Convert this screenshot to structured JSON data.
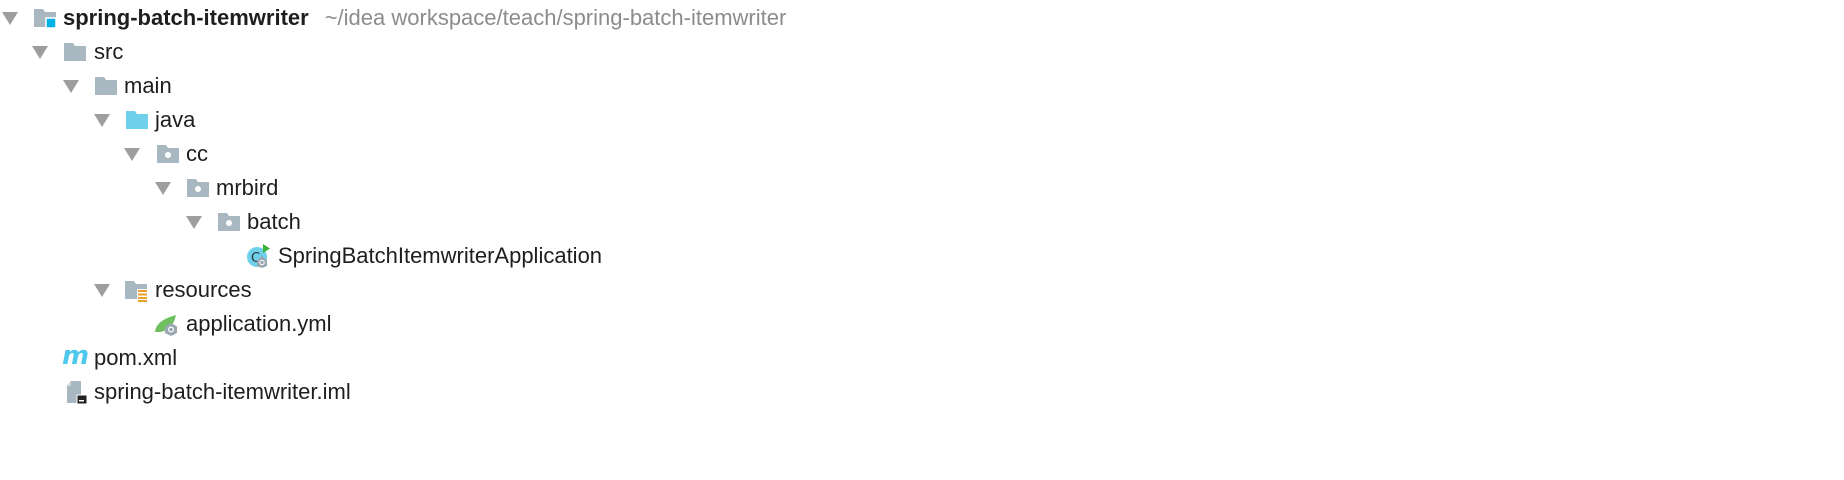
{
  "project": {
    "name": "spring-batch-itemwriter",
    "path": "~/idea workspace/teach/spring-batch-itemwriter"
  },
  "tree": {
    "src": "src",
    "main": "main",
    "java": "java",
    "cc": "cc",
    "mrbird": "mrbird",
    "batch": "batch",
    "app_class": "SpringBatchItemwriterApplication",
    "resources": "resources",
    "app_yml": "application.yml",
    "pom": "pom.xml",
    "iml": "spring-batch-itemwriter.iml"
  },
  "colors": {
    "folder": "#a9b7c0",
    "source_folder": "#6fd0ec",
    "module_badge": "#00b2e6",
    "resources_badge": "#e8a22b",
    "spring": "#6dbf5f",
    "arrow": "#9e9e9e"
  }
}
